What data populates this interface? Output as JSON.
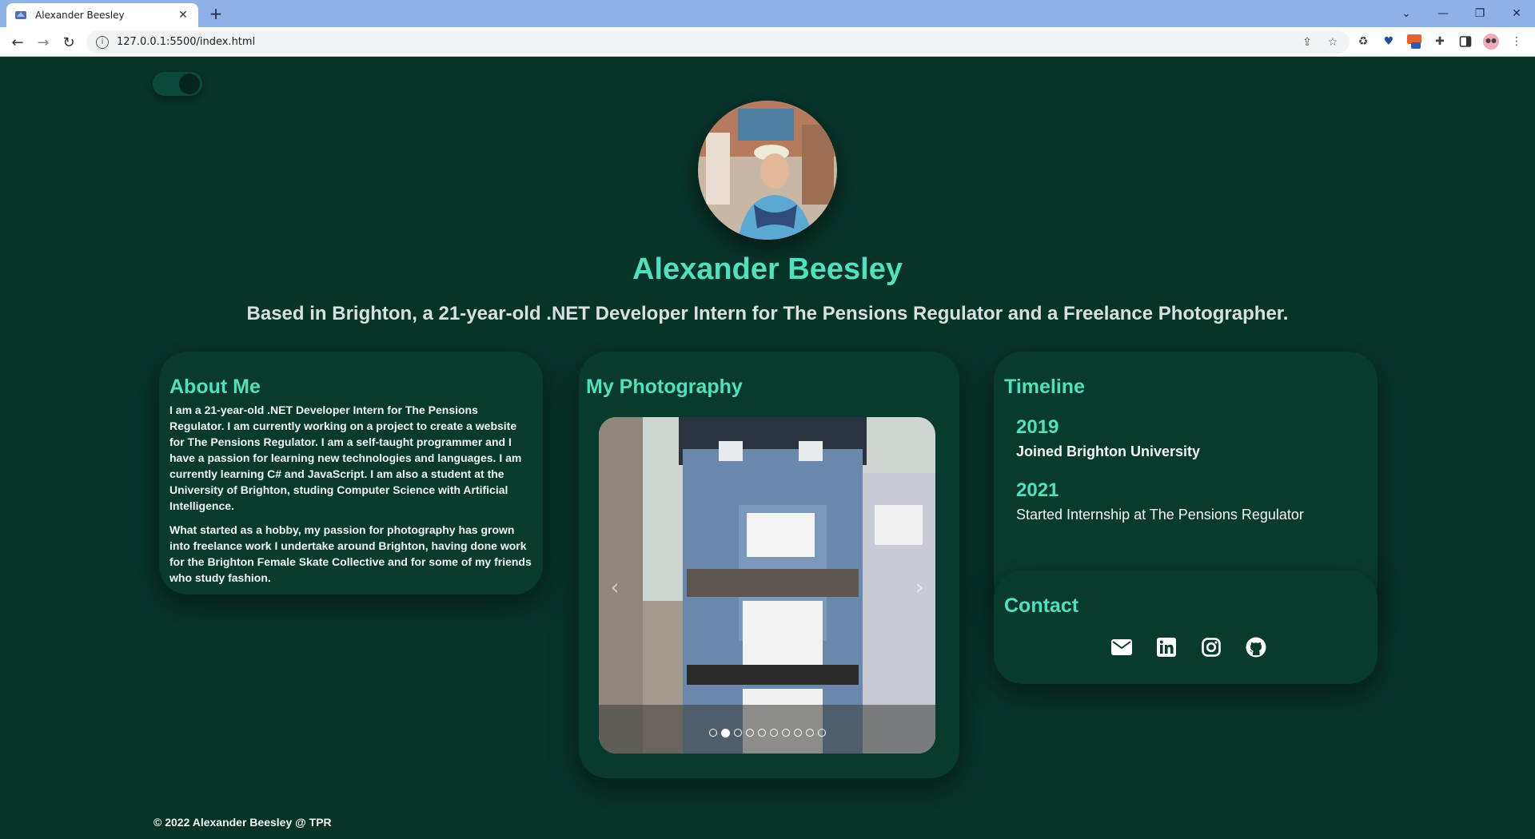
{
  "browser": {
    "tab_title": "Alexander Beesley",
    "url": "127.0.0.1:5500/index.html"
  },
  "header": {
    "name": "Alexander Beesley",
    "tagline": "Based in Brighton, a 21-year-old .NET Developer Intern for The Pensions Regulator and a Freelance Photographer."
  },
  "about": {
    "heading": "About Me",
    "paragraphs": [
      "I am a 21-year-old .NET Developer Intern for The Pensions Regulator. I am currently working on a project to create a website for The Pensions Regulator. I am a self-taught programmer and I have a passion for learning new technologies and languages. I am currently learning C# and JavaScript. I am also a student at the University of Brighton, studing Computer Science with Artificial Intelligence.",
      "What started as a hobby, my passion for photography has grown into freelance work I undertake around Brighton, having done work for the Brighton Female Skate Collective and for some of my friends who study fashion."
    ]
  },
  "photography": {
    "heading": "My Photography",
    "slide_count": 10,
    "active_slide": 2,
    "prev_icon": "chevron-left-icon",
    "next_icon": "chevron-right-icon"
  },
  "timeline": {
    "heading": "Timeline",
    "items": [
      {
        "year": "2019",
        "text": "Joined Brighton University"
      },
      {
        "year": "2021",
        "text": "Started Internship at The Pensions Regulator"
      }
    ]
  },
  "contact": {
    "heading": "Contact",
    "icons": [
      "envelope-icon",
      "linkedin-icon",
      "instagram-icon",
      "github-icon"
    ]
  },
  "footer": {
    "text": "© 2022 Alexander Beesley @ TPR"
  },
  "colors": {
    "background": "#083329",
    "card": "#093a2e",
    "accent": "#4fe0bc",
    "text": "#f2f6f5"
  }
}
